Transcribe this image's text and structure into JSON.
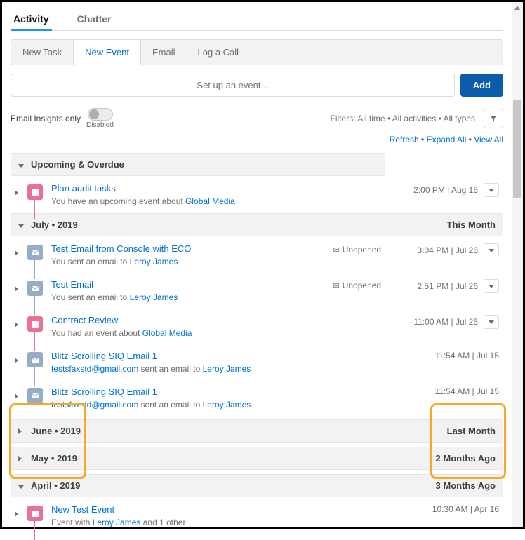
{
  "tabs": {
    "activity": "Activity",
    "chatter": "Chatter"
  },
  "actionTabs": {
    "newTask": "New Task",
    "newEvent": "New Event",
    "email": "Email",
    "logCall": "Log a Call"
  },
  "input": {
    "placeholder": "Set up an event...",
    "addBtn": "Add"
  },
  "insights": {
    "label": "Email Insights only",
    "toggleState": "Disabled"
  },
  "filters": {
    "text": "Filters: All time • All activities • All types"
  },
  "links": {
    "refresh": "Refresh",
    "expandAll": "Expand All",
    "viewAll": "View All"
  },
  "sections": {
    "upcoming": {
      "title": "Upcoming & Overdue"
    },
    "july": {
      "title": "July  •  2019",
      "badge": "This Month"
    },
    "june": {
      "title": "June  •  2019",
      "badge": "Last Month"
    },
    "may": {
      "title": "May  •  2019",
      "badge": "2 Months Ago"
    },
    "april": {
      "title": "April  •  2019",
      "badge": "3 Months Ago"
    }
  },
  "items": {
    "planAudit": {
      "title": "Plan audit tasks",
      "sub1": "You have an upcoming event about ",
      "link": "Global Media",
      "time": "2:00 PM | Aug 15"
    },
    "testEmailEco": {
      "title": "Test Email from Console with ECO",
      "status": "Unopened",
      "sub1": "You sent an email to ",
      "link": "Leroy James",
      "time": "3:04 PM | Jul 26"
    },
    "testEmail": {
      "title": "Test Email",
      "status": "Unopened",
      "sub1": "You sent an email to ",
      "link": "Leroy James",
      "time": "2:51 PM | Jul 26"
    },
    "contractReview": {
      "title": "Contract Review",
      "sub1": "You had an event about ",
      "link": "Global Media",
      "time": "11:00 AM | Jul 25"
    },
    "blitz1": {
      "title": "Blitz Scrolling SIQ Email 1",
      "subEmail": "testsfaxstd@gmail.com",
      "subText": " sent an email to ",
      "link": "Leroy James",
      "time": "11:54 AM | Jul 15"
    },
    "blitz2": {
      "title": "Blitz Scrolling SIQ Email 1",
      "subEmail": "testsfaxstd@gmail.com",
      "subText": " sent an email to ",
      "link": "Leroy James",
      "time": "11:54 AM | Jul 15"
    },
    "newTestEvent": {
      "title": "New Test Event",
      "sub1": "Event with ",
      "link": "Leroy James",
      "sub2": " and 1 other",
      "time": "10:30 AM | Apr 16"
    }
  }
}
